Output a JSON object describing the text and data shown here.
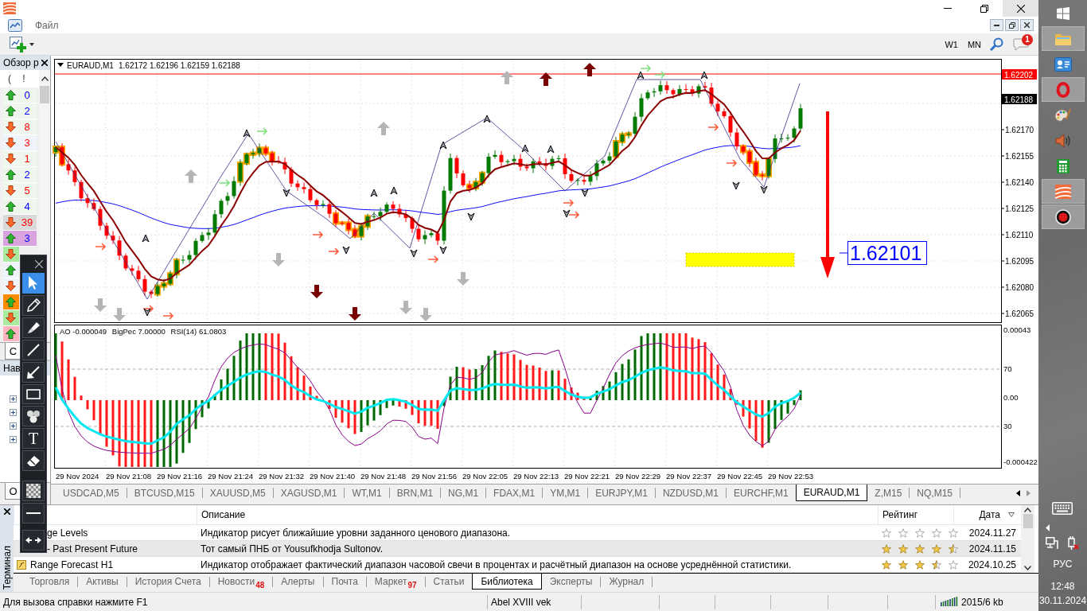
{
  "window": {
    "menu": [
      "Файл"
    ],
    "timeframes": [
      "W1",
      "MN"
    ],
    "notifications": "1"
  },
  "market_watch": {
    "title": "Обзор р",
    "columns": [
      "(",
      "!"
    ],
    "rows": [
      {
        "rising": true,
        "value": "0",
        "color": "#eef6ee"
      },
      {
        "rising": true,
        "value": "2",
        "color": "#eef6ee"
      },
      {
        "rising": false,
        "value": "8",
        "color": "#eef6ee"
      },
      {
        "rising": false,
        "value": "3",
        "color": "#eef4fa"
      },
      {
        "rising": false,
        "value": "1",
        "color": "#eef6ee"
      },
      {
        "rising": true,
        "value": "2",
        "color": "#eef6ee"
      },
      {
        "rising": false,
        "value": "5",
        "color": "#eef6ee"
      },
      {
        "rising": true,
        "value": "4",
        "color": "#eef6ee"
      },
      {
        "rising": false,
        "value": "39",
        "color": "#d9d9d9"
      },
      {
        "rising": true,
        "value": "3",
        "color": "#d9a3e0"
      },
      {
        "rising": false,
        "color": "#a9ec9f"
      },
      {
        "rising": true,
        "color": "#eef4fa"
      },
      {
        "rising": false,
        "color": "#eef4fa"
      },
      {
        "rising": true,
        "color": "#ff8c00"
      },
      {
        "rising": false,
        "color": "#a9ec9f"
      },
      {
        "rising": true,
        "color": "#ffb3c0"
      }
    ],
    "tab": "С"
  },
  "navigator": {
    "title": "Нав",
    "items": [
      {
        "expanded": false
      },
      {
        "expanded": false
      },
      {
        "expanded": false
      },
      {
        "expanded": false
      }
    ],
    "tab": "О"
  },
  "drawing_tools": [
    {
      "kind": "cursor",
      "selected": true
    },
    {
      "kind": "pencil",
      "selected": false
    },
    {
      "kind": "highlighter",
      "selected": false
    },
    {
      "kind": "line",
      "selected": false
    },
    {
      "kind": "arrow",
      "selected": false
    },
    {
      "kind": "rectangle",
      "selected": false
    },
    {
      "kind": "numbers",
      "selected": false
    },
    {
      "kind": "text",
      "label": "T",
      "selected": false
    },
    {
      "kind": "eraser",
      "selected": false
    },
    {
      "kind": "opacity",
      "selected": false
    },
    {
      "kind": "thickness",
      "selected": false
    },
    {
      "kind": "expand",
      "selected": false
    }
  ],
  "chart": {
    "symbol": "EURAUD,M1",
    "ohlc": "1.62172 1.62196 1.62159 1.62188",
    "price_ticks": [
      "1.62170",
      "1.62155",
      "1.62140",
      "1.62125",
      "1.62110",
      "1.62095",
      "1.62080",
      "1.62065"
    ],
    "level_price": "1.62202",
    "bid_price": "1.62188",
    "price_label": "1.62101"
  },
  "indicator": {
    "legend": [
      "AO -0.000049",
      "BigPec 7.00000",
      "RSI(14) 61.0803"
    ],
    "ticks": [
      "0.00043",
      "70",
      "0.00",
      "30",
      "-0.000422"
    ]
  },
  "time_axis": [
    "29 Nov 2024",
    "29 Nov 21:08",
    "29 Nov 21:16",
    "29 Nov 21:24",
    "29 Nov 21:32",
    "29 Nov 21:40",
    "29 Nov 21:48",
    "29 Nov 21:56",
    "29 Nov 22:05",
    "29 Nov 22:13",
    "29 Nov 22:21",
    "29 Nov 22:29",
    "29 Nov 22:37",
    "29 Nov 22:45",
    "29 Nov 22:53"
  ],
  "chart_tabs": [
    {
      "label": "USDCAD,M5",
      "selected": false
    },
    {
      "label": "BTCUSD,M15",
      "selected": false
    },
    {
      "label": "XAUUSD,M5",
      "selected": false
    },
    {
      "label": "XAGUSD,M1",
      "selected": false
    },
    {
      "label": "WT,M1",
      "selected": false
    },
    {
      "label": "BRN,M1",
      "selected": false
    },
    {
      "label": "NG,M1",
      "selected": false
    },
    {
      "label": "FDAX,M1",
      "selected": false
    },
    {
      "label": "YM,M1",
      "selected": false
    },
    {
      "label": "EURJPY,M1",
      "selected": false
    },
    {
      "label": "NZDUSD,M1",
      "selected": false
    },
    {
      "label": "EURCHF,M1",
      "selected": false
    },
    {
      "label": "EURAUD,M1",
      "selected": true
    },
    {
      "label": "Z,M15",
      "selected": false
    },
    {
      "label": "NQ,M15",
      "selected": false
    }
  ],
  "terminal": {
    "title": "Терминал",
    "columns": [
      "Описание",
      "Рейтинг",
      "Дата"
    ],
    "rows": [
      {
        "name": "ge Levels",
        "description": "Индикатор рисует ближайшие уровни заданного ценового диапазона.",
        "stars": 0,
        "date": "2024.11.27",
        "selected": false
      },
      {
        "name": "- Past Present Future",
        "description": "Тот самый ПНБ от Yousufkhodja Sultonov.",
        "stars": 4.5,
        "date": "2024.11.15",
        "selected": true
      },
      {
        "name": "Range Forecast H1",
        "description": "Индикатор отображает фактический диапазон часовой свечи в процентах и расчётный диапазон на основе усреднённой статистики.",
        "stars": 3.5,
        "date": "2024.10.25",
        "selected": false
      }
    ],
    "tabs": [
      {
        "label": "Торговля",
        "selected": false
      },
      {
        "label": "Активы",
        "selected": false
      },
      {
        "label": "История Счета",
        "selected": false
      },
      {
        "label": "Новости",
        "badge": "48",
        "selected": false
      },
      {
        "label": "Алерты",
        "selected": false
      },
      {
        "label": "Почта",
        "selected": false
      },
      {
        "label": "Маркет",
        "badge": "97",
        "selected": false
      },
      {
        "label": "Статьи",
        "selected": false
      },
      {
        "label": "Библиотека",
        "selected": true
      },
      {
        "label": "Эксперты",
        "selected": false
      },
      {
        "label": "Журнал",
        "selected": false
      }
    ]
  },
  "status_bar": {
    "help": "Для вызова справки нажмите F1",
    "profile": "Abel XVIII vek",
    "traffic": "2015/6 kb"
  },
  "taskbar": {
    "apps": [
      {
        "kind": "start",
        "running": false
      },
      {
        "kind": "folder",
        "running": true
      },
      {
        "kind": "card",
        "running": false
      },
      {
        "kind": "ring",
        "running": true
      },
      {
        "kind": "palette",
        "running": false
      },
      {
        "kind": "speaker",
        "running": false
      },
      {
        "kind": "calculator",
        "running": false
      },
      {
        "kind": "stripes",
        "running": true
      },
      {
        "kind": "record",
        "running": true
      }
    ],
    "language": "РУС",
    "time": "12:48",
    "date": "30.11.2024"
  }
}
